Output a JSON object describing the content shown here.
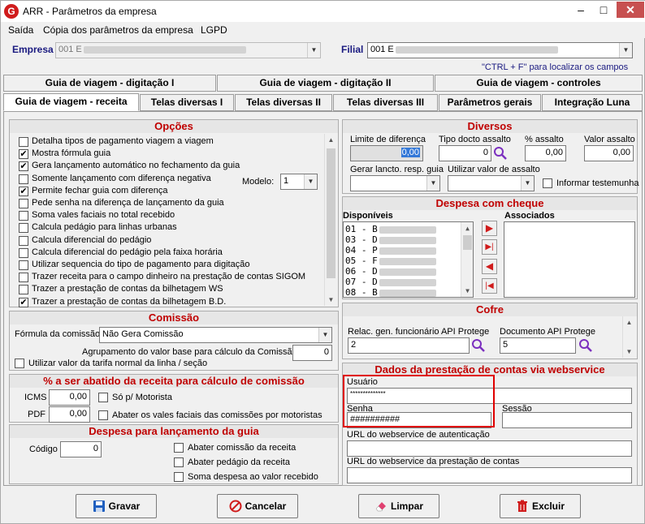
{
  "window": {
    "title": "ARR - Parâmetros da empresa",
    "minimize": "–",
    "maximize": "□",
    "close": "✕"
  },
  "menu": {
    "items": [
      "Saída",
      "Cópia dos parâmetros da empresa",
      "LGPD"
    ]
  },
  "header": {
    "empresa_label": "Empresa",
    "empresa_value": "001 E",
    "filial_label": "Filial",
    "filial_value": "001 E",
    "hint": "\"CTRL + F\" para localizar os campos"
  },
  "tabs_row1": [
    "Guia de viagem - digitação I",
    "Guia de viagem - digitação II",
    "Guia de viagem - controles"
  ],
  "tabs_row2": [
    "Guia de viagem - receita",
    "Telas diversas I",
    "Telas diversas II",
    "Telas diversas III",
    "Parâmetros gerais",
    "Integração Luna"
  ],
  "opcoes": {
    "title": "Opções",
    "modelo_label": "Modelo:",
    "modelo_value": "1",
    "items": [
      {
        "label": "Detalha tipos de pagamento viagem a viagem",
        "checked": false
      },
      {
        "label": "Mostra fórmula guia",
        "checked": true
      },
      {
        "label": "Gera lançamento automático no fechamento da guia",
        "checked": true
      },
      {
        "label": "Somente lançamento com diferença negativa",
        "checked": false
      },
      {
        "label": "Permite fechar guia com diferença",
        "checked": true
      },
      {
        "label": "Pede senha na diferença de lançamento da guia",
        "checked": false
      },
      {
        "label": "Soma vales faciais no total recebido",
        "checked": false
      },
      {
        "label": "Calcula pedágio para linhas urbanas",
        "checked": false
      },
      {
        "label": "Calcula diferencial do pedágio",
        "checked": false
      },
      {
        "label": "Calcula diferencial do pedágio pela faixa horária",
        "checked": false
      },
      {
        "label": "Utilizar sequencia do tipo de pagamento para digitação",
        "checked": false
      },
      {
        "label": "Trazer receita para o campo dinheiro na prestação de contas SIGOM",
        "checked": false
      },
      {
        "label": "Trazer a prestação de contas da bilhetagem WS",
        "checked": false
      },
      {
        "label": "Trazer a prestação de contas da bilhetagem B.D.",
        "checked": true
      }
    ],
    "check_mark": "✔"
  },
  "comissao": {
    "title": "Comissão",
    "formula_label": "Fórmula da comissão",
    "formula_value": "Não Gera Comissão",
    "agrup_label": "Agrupamento do valor base para cálculo da Comissão",
    "agrup_value": "0",
    "tarifa_label": "Utilizar valor da tarifa normal da linha / seção"
  },
  "abatido": {
    "title": "% a ser abatido da receita para cálculo de comissão",
    "icms_label": "ICMS",
    "icms_value": "0,00",
    "pdf_label": "PDF",
    "pdf_value": "0,00",
    "motorista_label": "Só p/ Motorista",
    "vales_label": "Abater os vales faciais das comissões por motoristas"
  },
  "despesa_lanc": {
    "title": "Despesa para lançamento da guia",
    "codigo_label": "Código",
    "codigo_value": "0",
    "checks": [
      "Abater comissão da receita",
      "Abater pedágio da receita",
      "Soma despesa ao valor recebido"
    ]
  },
  "diversos": {
    "title": "Diversos",
    "limite_label": "Limite de diferença",
    "limite_value": "0,00",
    "tipo_label": "Tipo docto assalto",
    "tipo_value": "0",
    "pct_label": "% assalto",
    "pct_value": "0,00",
    "valor_label": "Valor assalto",
    "valor_value": "0,00",
    "gerar_label": "Gerar lancto. resp. guia",
    "utilizar_label": "Utilizar valor de assalto",
    "testemunha_label": "Informar testemunha"
  },
  "cheque": {
    "title": "Despesa com cheque",
    "disp_label": "Disponíveis",
    "assoc_label": "Associados",
    "items": [
      "01 - B",
      "03 - D",
      "04 - P",
      "05 - F",
      "06 - D",
      "07 - D",
      "08 - B"
    ],
    "btn_add": "▶",
    "btn_add_all": "▶|",
    "btn_remove": "◀",
    "btn_remove_all": "|◀"
  },
  "cofre": {
    "title": "Cofre",
    "relac_label": "Relac. gen. funcionário API Protege",
    "relac_value": "2",
    "doc_label": "Documento API Protege",
    "doc_value": "5"
  },
  "webservice": {
    "title": "Dados da prestação de contas via webservice",
    "usuario_label": "Usuário",
    "usuario_value": "**************",
    "senha_label": "Senha",
    "senha_value": "##########",
    "sessao_label": "Sessão",
    "url_auth_label": "URL do webservice de autenticação",
    "url_prest_label": "URL do webservice da prestação de contas"
  },
  "buttons": {
    "gravar": "Gravar",
    "cancelar": "Cancelar",
    "limpar": "Limpar",
    "excluir": "Excluir"
  },
  "colors": {
    "accent_red": "#c00000",
    "highlight_box": "#e00000",
    "icon_purple": "#7b2fbf"
  }
}
